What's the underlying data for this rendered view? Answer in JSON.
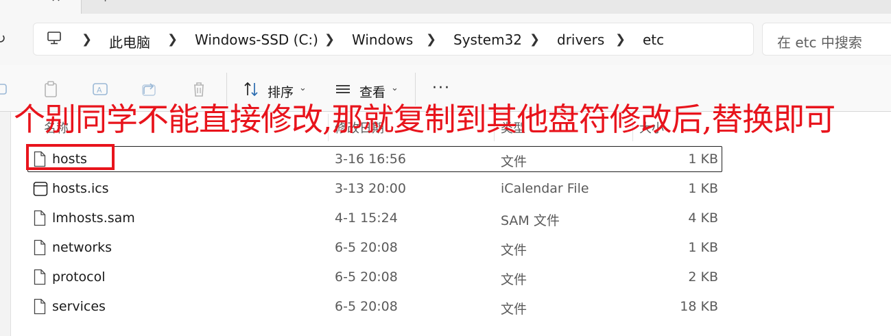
{
  "tabs": {
    "new_tab_label": "+",
    "close_label": "×"
  },
  "breadcrumb": [
    "此电脑",
    "Windows-SSD (C:)",
    "Windows",
    "System32",
    "drivers",
    "etc"
  ],
  "search": {
    "placeholder": "在 etc 中搜索"
  },
  "toolbar": {
    "sort_label": "排序",
    "view_label": "查看",
    "more_label": "···"
  },
  "columns": {
    "name": "名称",
    "modified": "修改日期",
    "type": "类型",
    "size": "大小"
  },
  "files": [
    {
      "name": "hosts",
      "modified": "3-16 16:56",
      "type": "文件",
      "size": "1 KB",
      "icon": "file-icon"
    },
    {
      "name": "hosts.ics",
      "modified": "3-13 20:00",
      "type": "iCalendar File",
      "size": "1 KB",
      "icon": "calendar-file-icon"
    },
    {
      "name": "lmhosts.sam",
      "modified": "4-1 15:24",
      "type": "SAM 文件",
      "size": "4 KB",
      "icon": "file-icon"
    },
    {
      "name": "networks",
      "modified": "6-5 20:08",
      "type": "文件",
      "size": "1 KB",
      "icon": "file-icon"
    },
    {
      "name": "protocol",
      "modified": "6-5 20:08",
      "type": "文件",
      "size": "2 KB",
      "icon": "file-icon"
    },
    {
      "name": "services",
      "modified": "6-5 20:08",
      "type": "文件",
      "size": "18 KB",
      "icon": "file-icon"
    }
  ],
  "annotation": {
    "text": "个别同学不能直接修改,那就复制到其他盘符修改后,替换即可",
    "color": "#e8141c"
  }
}
